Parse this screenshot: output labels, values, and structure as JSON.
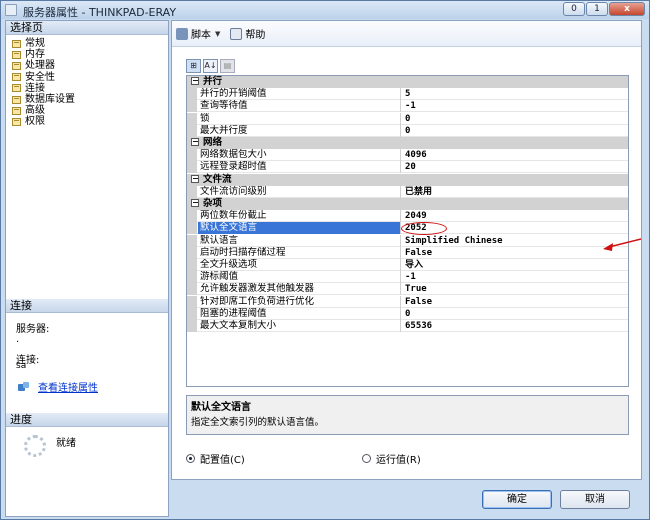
{
  "window": {
    "title": "服务器属性 - THINKPAD-ERAY",
    "min": "0",
    "max": "1",
    "close": "x"
  },
  "left": {
    "pages_header": "选择页",
    "pages": [
      "常规",
      "内存",
      "处理器",
      "安全性",
      "连接",
      "数据库设置",
      "高级",
      "权限"
    ],
    "connection_header": "连接",
    "server_label": "服务器:",
    "server_value": ".",
    "connect_label": "连接:",
    "connect_value": "sa",
    "view_conn_props": "查看连接属性",
    "progress_header": "进度",
    "status": "就绪"
  },
  "toolbar": {
    "script": "脚本",
    "help": "帮助"
  },
  "grid_tools": {
    "categorized": "⊞",
    "alpha": "A↓",
    "props": "▤"
  },
  "grid": {
    "categories": [
      {
        "name": "并行",
        "expander": "−",
        "props": [
          {
            "name": "并行的开销阈值",
            "value": "5"
          },
          {
            "name": "查询等待值",
            "value": "-1"
          },
          {
            "name": "锁",
            "value": "0"
          },
          {
            "name": "最大并行度",
            "value": "0"
          }
        ]
      },
      {
        "name": "网络",
        "expander": "−",
        "props": [
          {
            "name": "网络数据包大小",
            "value": "4096"
          },
          {
            "name": "远程登录超时值",
            "value": "20"
          }
        ]
      },
      {
        "name": "文件流",
        "expander": "−",
        "props": [
          {
            "name": "文件流访问级别",
            "value": "已禁用"
          }
        ]
      },
      {
        "name": "杂项",
        "expander": "−",
        "props": [
          {
            "name": "两位数年份截止",
            "value": "2049"
          },
          {
            "name": "默认全文语言",
            "value": "2052"
          },
          {
            "name": "默认语言",
            "value": "Simplified Chinese"
          },
          {
            "name": "启动时扫描存储过程",
            "value": "False"
          },
          {
            "name": "全文升级选项",
            "value": "导入"
          },
          {
            "name": "游标阈值",
            "value": "-1"
          },
          {
            "name": "允许触发器激发其他触发器",
            "value": "True"
          },
          {
            "name": "针对即席工作负荷进行优化",
            "value": "False"
          },
          {
            "name": "阻塞的进程阈值",
            "value": "0"
          },
          {
            "name": "最大文本复制大小",
            "value": "65536"
          }
        ]
      }
    ]
  },
  "description": {
    "title": "默认全文语言",
    "text": "指定全文索引列的默认语言值。"
  },
  "radios": {
    "configured": "配置值(C)",
    "running": "运行值(R)",
    "selected": "configured"
  },
  "buttons": {
    "ok": "确定",
    "cancel": "取消"
  },
  "colors": {
    "selection": "#3875d7",
    "annotation": "#d01010",
    "category_bg": "#d2d2d2"
  }
}
